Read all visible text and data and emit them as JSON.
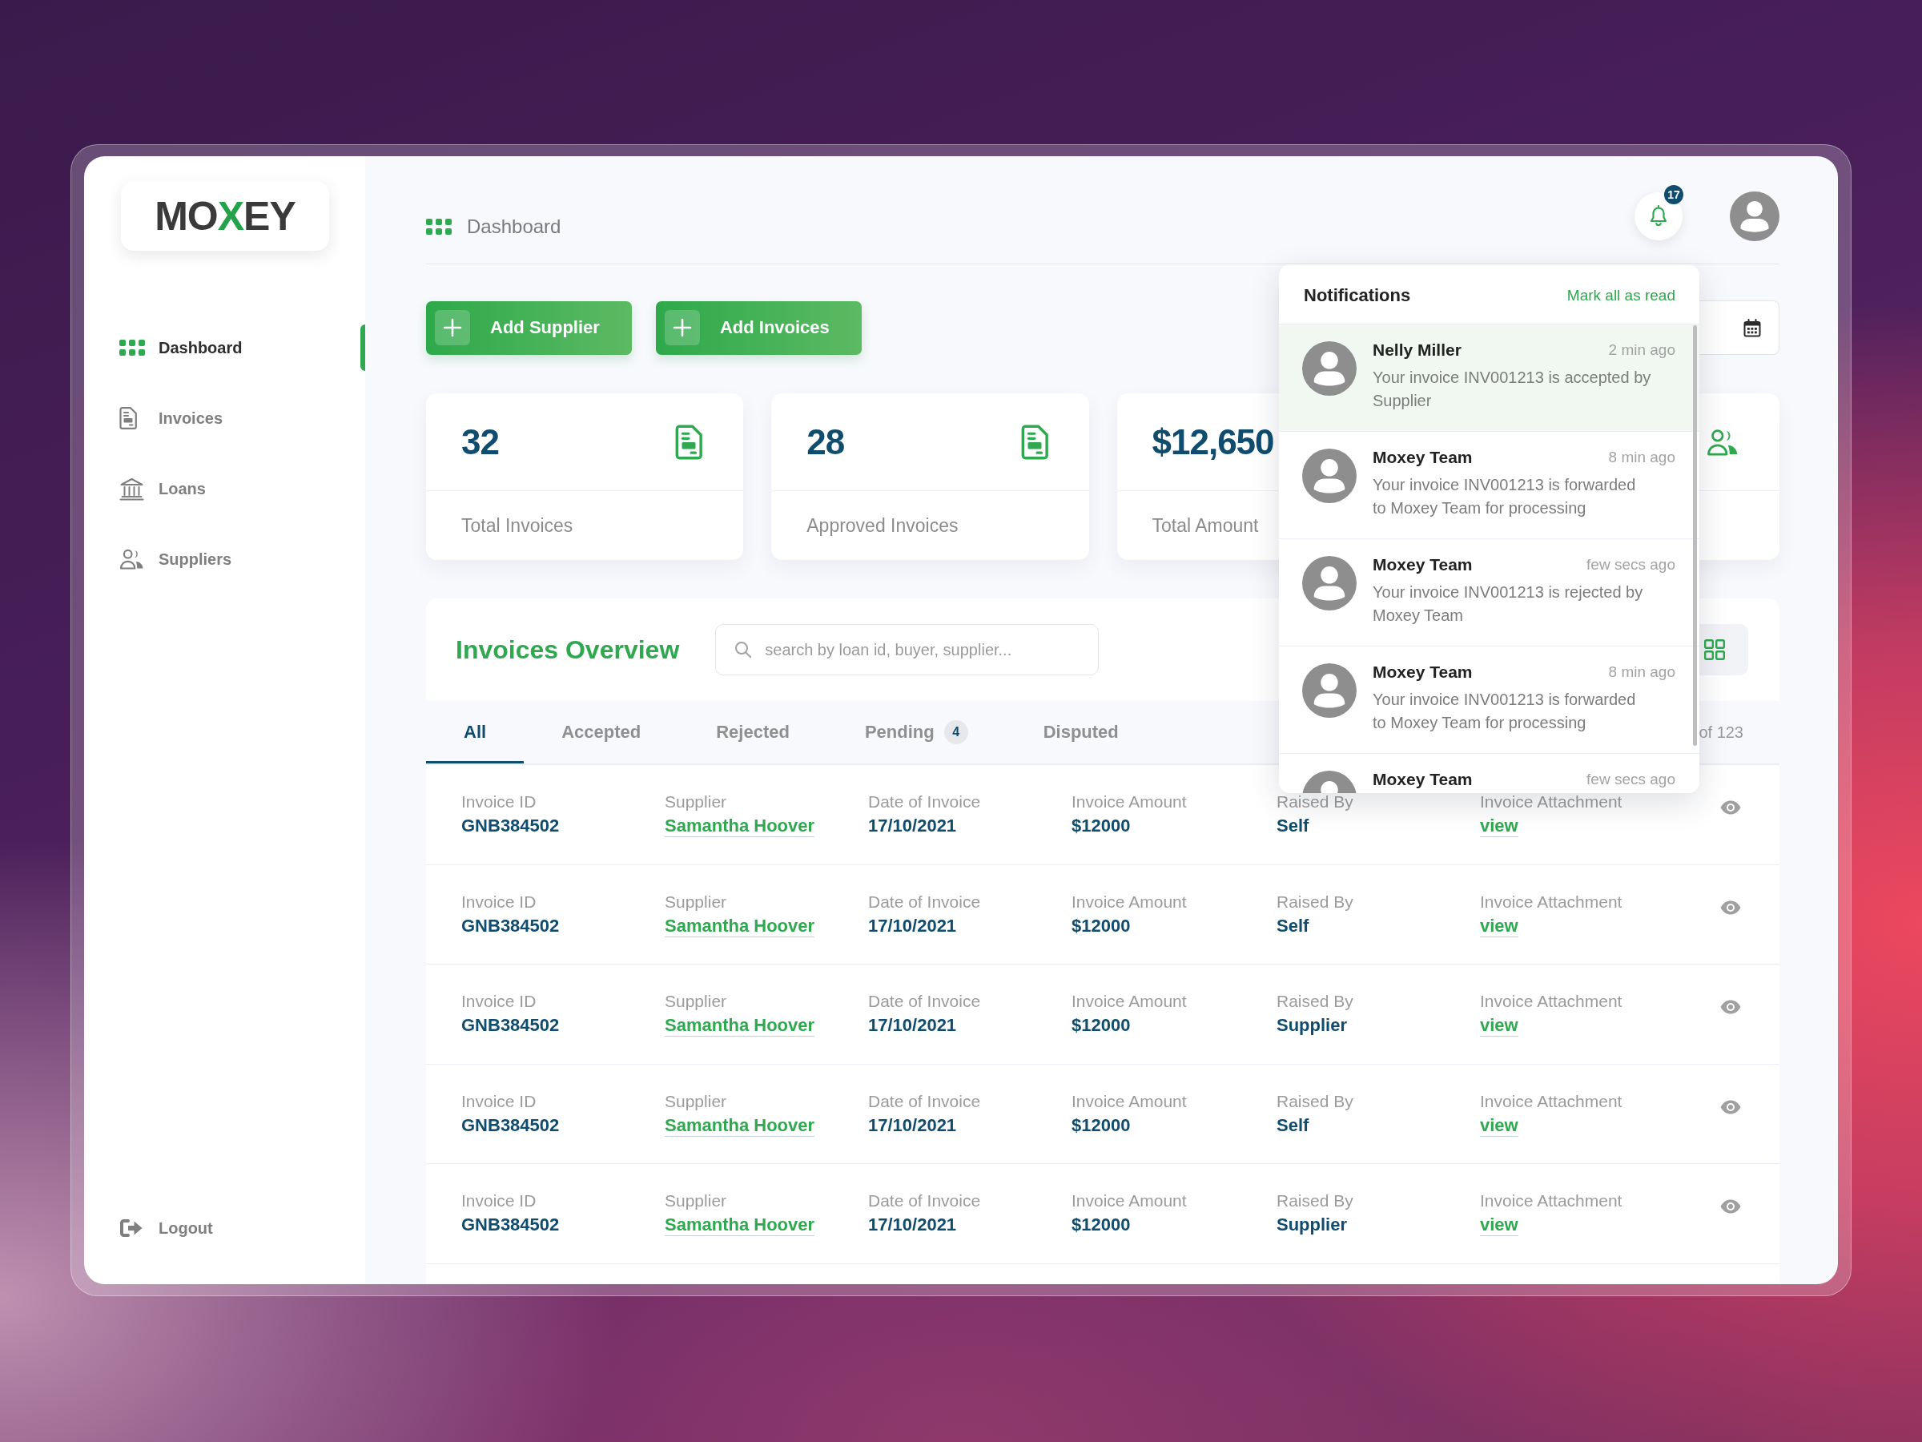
{
  "sidebar": {
    "logo": [
      {
        "text": "MO",
        "accent": false
      },
      {
        "text": "X",
        "accent": true
      },
      {
        "text": "EY",
        "accent": false
      }
    ],
    "items": [
      {
        "label": "Dashboard",
        "selected": true
      },
      {
        "label": "Invoices",
        "selected": false
      },
      {
        "label": "Loans",
        "selected": false
      },
      {
        "label": "Suppliers",
        "selected": false
      }
    ],
    "logout": "Logout"
  },
  "header": {
    "breadcrumb": "Dashboard",
    "notification_count": "17"
  },
  "actions": [
    "Add Supplier",
    "Add Invoices"
  ],
  "stats": [
    {
      "kind": "count",
      "value": "32",
      "label": "Total Invoices"
    },
    {
      "kind": "count",
      "value": "28",
      "label": "Approved Invoices"
    },
    {
      "kind": "amount",
      "value": "$12,650",
      "label": "Total Amount"
    },
    {
      "kind": "suppliers"
    }
  ],
  "overview": {
    "title": "Invoices Overview",
    "search": {
      "placeholder": "search by loan id, buyer, supplier..."
    },
    "tabs": [
      {
        "label": "All",
        "selected": true
      },
      {
        "label": "Accepted",
        "selected": false
      },
      {
        "label": "Rejected",
        "selected": false
      },
      {
        "label": "Pending",
        "selected": false,
        "count": "4"
      },
      {
        "label": "Disputed",
        "selected": false
      }
    ],
    "pagination": "of 123",
    "rows": [
      {
        "cells": [
          {
            "kind": "text",
            "label": "Invoice ID",
            "value": "GNB384502"
          },
          {
            "kind": "link",
            "label": "Supplier",
            "value": "Samantha Hoover"
          },
          {
            "kind": "text",
            "label": "Date of Invoice",
            "value": "17/10/2021"
          },
          {
            "kind": "text",
            "label": "Invoice Amount",
            "value": "$12000"
          },
          {
            "kind": "text",
            "label": "Raised By",
            "value": "Self"
          },
          {
            "kind": "link",
            "label": "Invoice Attachment",
            "value": "view"
          }
        ]
      },
      {
        "cells": [
          {
            "kind": "text",
            "label": "Invoice ID",
            "value": "GNB384502"
          },
          {
            "kind": "link",
            "label": "Supplier",
            "value": "Samantha Hoover"
          },
          {
            "kind": "text",
            "label": "Date of Invoice",
            "value": "17/10/2021"
          },
          {
            "kind": "text",
            "label": "Invoice Amount",
            "value": "$12000"
          },
          {
            "kind": "text",
            "label": "Raised By",
            "value": "Self"
          },
          {
            "kind": "link",
            "label": "Invoice Attachment",
            "value": "view"
          }
        ]
      },
      {
        "cells": [
          {
            "kind": "text",
            "label": "Invoice ID",
            "value": "GNB384502"
          },
          {
            "kind": "link",
            "label": "Supplier",
            "value": "Samantha Hoover"
          },
          {
            "kind": "text",
            "label": "Date of Invoice",
            "value": "17/10/2021"
          },
          {
            "kind": "text",
            "label": "Invoice Amount",
            "value": "$12000"
          },
          {
            "kind": "text",
            "label": "Raised By",
            "value": "Supplier"
          },
          {
            "kind": "link",
            "label": "Invoice Attachment",
            "value": "view"
          }
        ]
      },
      {
        "cells": [
          {
            "kind": "text",
            "label": "Invoice ID",
            "value": "GNB384502"
          },
          {
            "kind": "link",
            "label": "Supplier",
            "value": "Samantha Hoover"
          },
          {
            "kind": "text",
            "label": "Date of Invoice",
            "value": "17/10/2021"
          },
          {
            "kind": "text",
            "label": "Invoice Amount",
            "value": "$12000"
          },
          {
            "kind": "text",
            "label": "Raised By",
            "value": "Self"
          },
          {
            "kind": "link",
            "label": "Invoice Attachment",
            "value": "view"
          }
        ]
      },
      {
        "cells": [
          {
            "kind": "text",
            "label": "Invoice ID",
            "value": "GNB384502"
          },
          {
            "kind": "link",
            "label": "Supplier",
            "value": "Samantha Hoover"
          },
          {
            "kind": "text",
            "label": "Date of Invoice",
            "value": "17/10/2021"
          },
          {
            "kind": "text",
            "label": "Invoice Amount",
            "value": "$12000"
          },
          {
            "kind": "text",
            "label": "Raised By",
            "value": "Supplier"
          },
          {
            "kind": "link",
            "label": "Invoice Attachment",
            "value": "view"
          }
        ]
      }
    ]
  },
  "notifications": {
    "title": "Notifications",
    "action": "Mark all as read",
    "items": [
      {
        "name": "Nelly Miller",
        "time": "2 min ago",
        "message": "Your invoice INV001213 is accepted by Supplier",
        "highlighted": true
      },
      {
        "name": "Moxey Team",
        "time": "8 min ago",
        "message": "Your invoice INV001213 is forwarded to Moxey Team for processing",
        "highlighted": false
      },
      {
        "name": "Moxey Team",
        "time": "few secs ago",
        "message": "Your invoice INV001213 is rejected by Moxey Team",
        "highlighted": false
      },
      {
        "name": "Moxey Team",
        "time": "8 min ago",
        "message": "Your invoice INV001213 is forwarded to Moxey Team for processing",
        "highlighted": false
      },
      {
        "name": "Moxey Team",
        "time": "few secs ago",
        "highlighted": false
      }
    ]
  }
}
